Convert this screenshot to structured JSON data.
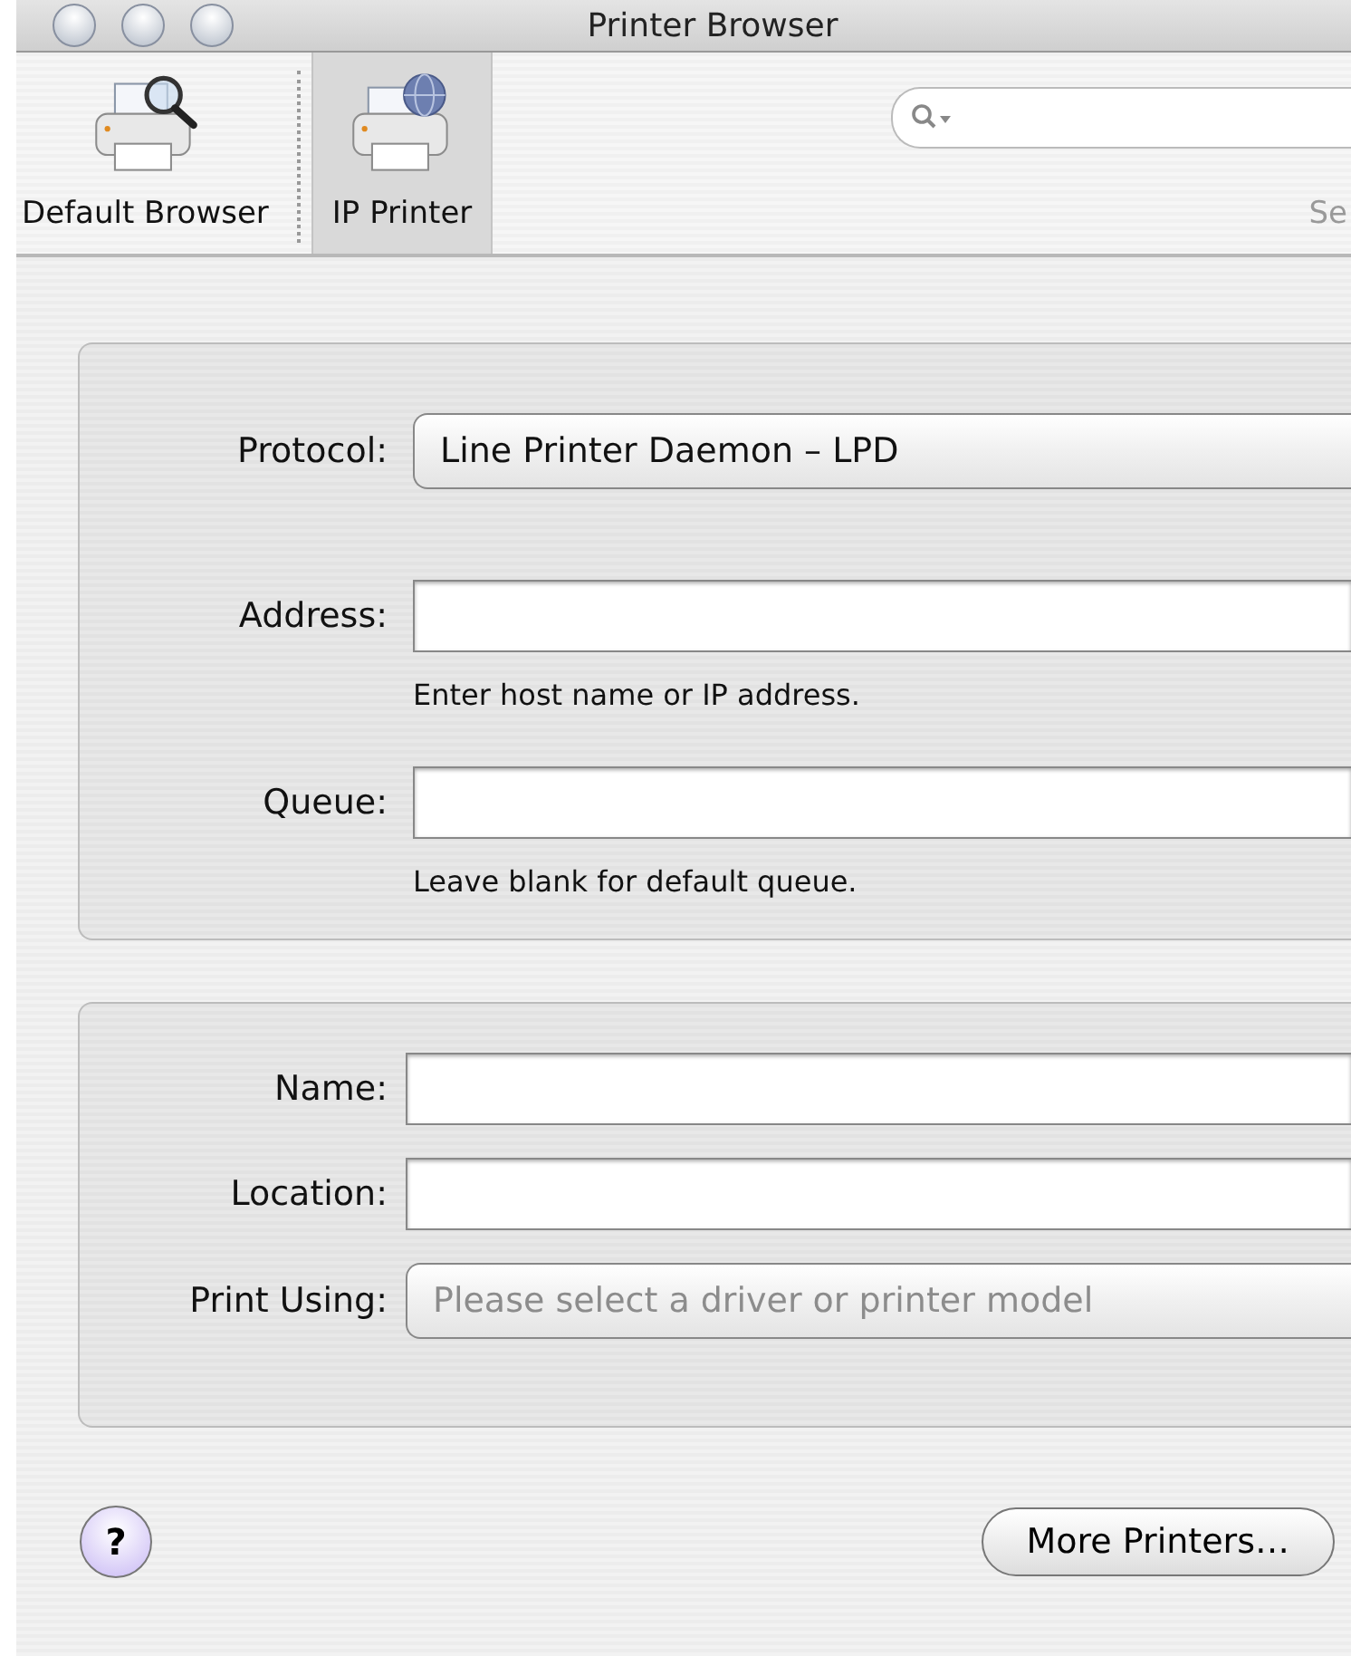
{
  "window": {
    "title": "Printer Browser"
  },
  "toolbar": {
    "items": [
      {
        "label": "Default Browser",
        "selected": false,
        "kind": "browse"
      },
      {
        "label": "IP Printer",
        "selected": true,
        "kind": "ip"
      }
    ],
    "search": {
      "label": "Se"
    }
  },
  "connection": {
    "protocol": {
      "label": "Protocol:",
      "value": "Line Printer Daemon – LPD"
    },
    "fields": [
      {
        "label": "Address:",
        "hint": "Enter host name or IP address."
      },
      {
        "label": "Queue:",
        "hint": "Leave blank for default queue."
      }
    ]
  },
  "printer": {
    "fields": [
      {
        "label": "Name:"
      },
      {
        "label": "Location:"
      }
    ],
    "print_using": {
      "label": "Print Using:",
      "placeholder": "Please select a driver or printer model",
      "disabled": true
    }
  },
  "buttons": {
    "help": "?",
    "more": "More Printers…"
  }
}
